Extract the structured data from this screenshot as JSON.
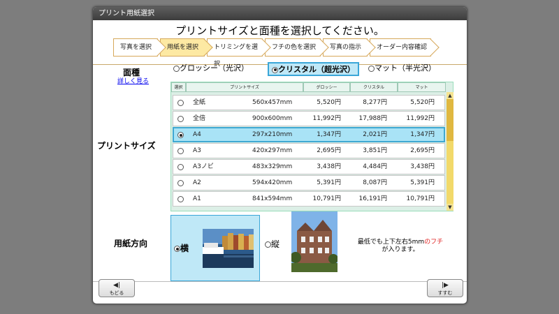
{
  "window": {
    "title": "プリント用紙選択"
  },
  "heading": "プリントサイズと面種を選択してください。",
  "steps": [
    {
      "label": "写真を選択",
      "active": false
    },
    {
      "label": "用紙を選択",
      "active": true
    },
    {
      "label": "トリミングを選択",
      "active": false
    },
    {
      "label": "フチの色を選択",
      "active": false
    },
    {
      "label": "写真の指示",
      "active": false
    },
    {
      "label": "オーダー内容確認",
      "active": false
    }
  ],
  "surface": {
    "label": "面種",
    "detail_link": "詳しく見る",
    "options": [
      {
        "label": "グロッシー（光沢）",
        "selected": false
      },
      {
        "label": "クリスタル（超光沢）",
        "selected": true
      },
      {
        "label": "マット（半光沢）",
        "selected": false
      }
    ]
  },
  "print_size": {
    "label": "プリントサイズ",
    "columns": [
      "選択",
      "プリントサイズ",
      "グロッシー",
      "クリスタル",
      "マット"
    ],
    "rows": [
      {
        "name": "全紙",
        "dims": "560x457mm",
        "glossy": "5,520円",
        "crystal": "8,277円",
        "matte": "5,520円",
        "selected": false
      },
      {
        "name": "全倍",
        "dims": "900x600mm",
        "glossy": "11,992円",
        "crystal": "17,988円",
        "matte": "11,992円",
        "selected": false
      },
      {
        "name": "A4",
        "dims": "297x210mm",
        "glossy": "1,347円",
        "crystal": "2,021円",
        "matte": "1,347円",
        "selected": true
      },
      {
        "name": "A3",
        "dims": "420x297mm",
        "glossy": "2,695円",
        "crystal": "3,851円",
        "matte": "2,695円",
        "selected": false
      },
      {
        "name": "A3ノビ",
        "dims": "483x329mm",
        "glossy": "3,438円",
        "crystal": "4,484円",
        "matte": "3,438円",
        "selected": false
      },
      {
        "name": "A2",
        "dims": "594x420mm",
        "glossy": "5,391円",
        "crystal": "8,087円",
        "matte": "5,391円",
        "selected": false
      },
      {
        "name": "A1",
        "dims": "841x594mm",
        "glossy": "10,791円",
        "crystal": "16,191円",
        "matte": "10,791円",
        "selected": false
      }
    ],
    "scroll_up_icon": "triangle-up-icon",
    "scroll_down_icon": "triangle-down-icon"
  },
  "orientation": {
    "label": "用紙方向",
    "landscape_label": "横",
    "portrait_label": "縦",
    "selected": "landscape",
    "note_before": "最低でも上下左右5mm",
    "note_red": "のフチ",
    "note_after": "が入ります。"
  },
  "nav": {
    "back_label": "もどる",
    "next_label": "すすむ",
    "back_icon": "step-back-icon",
    "next_icon": "step-forward-icon"
  },
  "colors": {
    "accent_blue": "#3aa6d8",
    "selected_bg": "#bfe8f7",
    "active_step": "#fde9a3",
    "note_red": "#e02020"
  }
}
